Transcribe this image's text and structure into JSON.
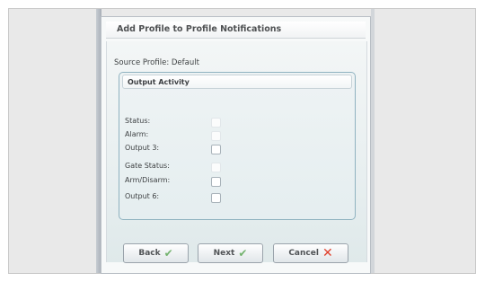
{
  "dialog": {
    "title": "Add Profile to Profile Notifications",
    "source_profile": "Source Profile: Default"
  },
  "group": {
    "title": "Output Activity",
    "rows": [
      {
        "label": "Status:",
        "checked": false
      },
      {
        "label": "Alarm:",
        "checked": false
      },
      {
        "label": "Output 3:",
        "checked": false
      },
      {
        "label": "Gate Status:",
        "checked": false
      },
      {
        "label": "Arm/Disarm:",
        "checked": false
      },
      {
        "label": "Output 6:",
        "checked": false
      }
    ]
  },
  "buttons": {
    "back": "Back",
    "next": "Next",
    "cancel": "Cancel"
  },
  "icons": {
    "back": "checkmark-icon",
    "next": "checkmark-icon",
    "cancel": "cross-icon"
  },
  "colors": {
    "check": "#74b36f",
    "cancel_x": "#e0402c",
    "group_border": "#8fb2c0"
  }
}
